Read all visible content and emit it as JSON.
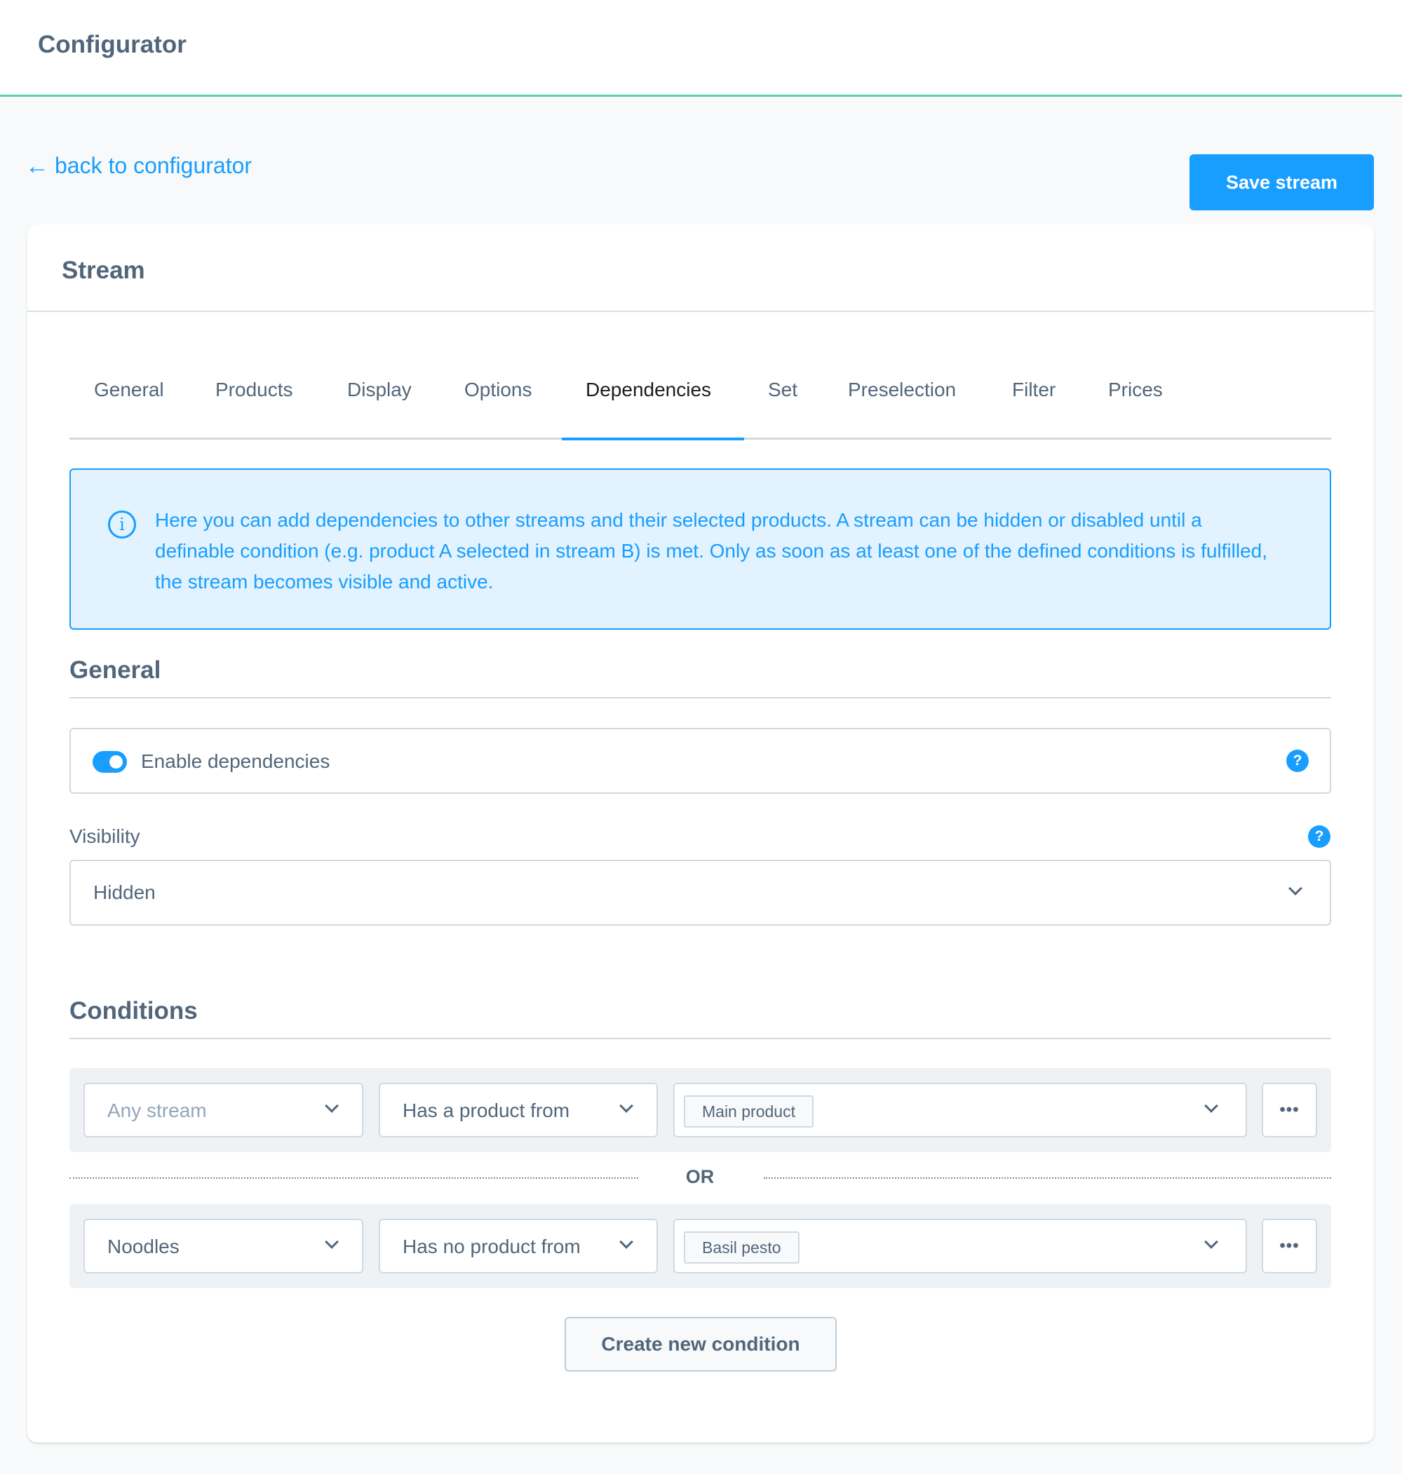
{
  "app": {
    "title": "Configurator",
    "accent_color": "#189eff",
    "header_border_color": "#57d39c"
  },
  "nav": {
    "back_arrow": "←",
    "back_label": "back to configurator"
  },
  "toolbar": {
    "save_label": "Save stream"
  },
  "card": {
    "title": "Stream"
  },
  "tabs": [
    {
      "label": "General",
      "active": false
    },
    {
      "label": "Products",
      "active": false
    },
    {
      "label": "Display",
      "active": false
    },
    {
      "label": "Options",
      "active": false
    },
    {
      "label": "Dependencies",
      "active": true
    },
    {
      "label": "Set",
      "active": false
    },
    {
      "label": "Preselection",
      "active": false
    },
    {
      "label": "Filter",
      "active": false
    },
    {
      "label": "Prices",
      "active": false
    }
  ],
  "info": {
    "icon": "info-icon",
    "icon_glyph": "i",
    "text": "Here you can add dependencies to other streams and their selected products. A stream can be hidden or disabled until a definable condition (e.g. product A selected in stream B) is met. Only as soon as at least one of the defined conditions is fulfilled, the stream becomes visible and active."
  },
  "general": {
    "heading": "General",
    "enable_dependencies": {
      "label": "Enable dependencies",
      "checked": true,
      "help_glyph": "?"
    },
    "visibility": {
      "label": "Visibility",
      "value": "Hidden",
      "help_glyph": "?"
    }
  },
  "conditions": {
    "heading": "Conditions",
    "separator_label": "OR",
    "more_glyph": "•••",
    "rows": [
      {
        "stream": "Any stream",
        "stream_is_placeholder": true,
        "operator": "Has a product from",
        "products": [
          "Main product"
        ]
      },
      {
        "stream": "Noodles",
        "stream_is_placeholder": false,
        "operator": "Has no product from",
        "products": [
          "Basil pesto"
        ]
      }
    ],
    "create_label": "Create new condition"
  }
}
